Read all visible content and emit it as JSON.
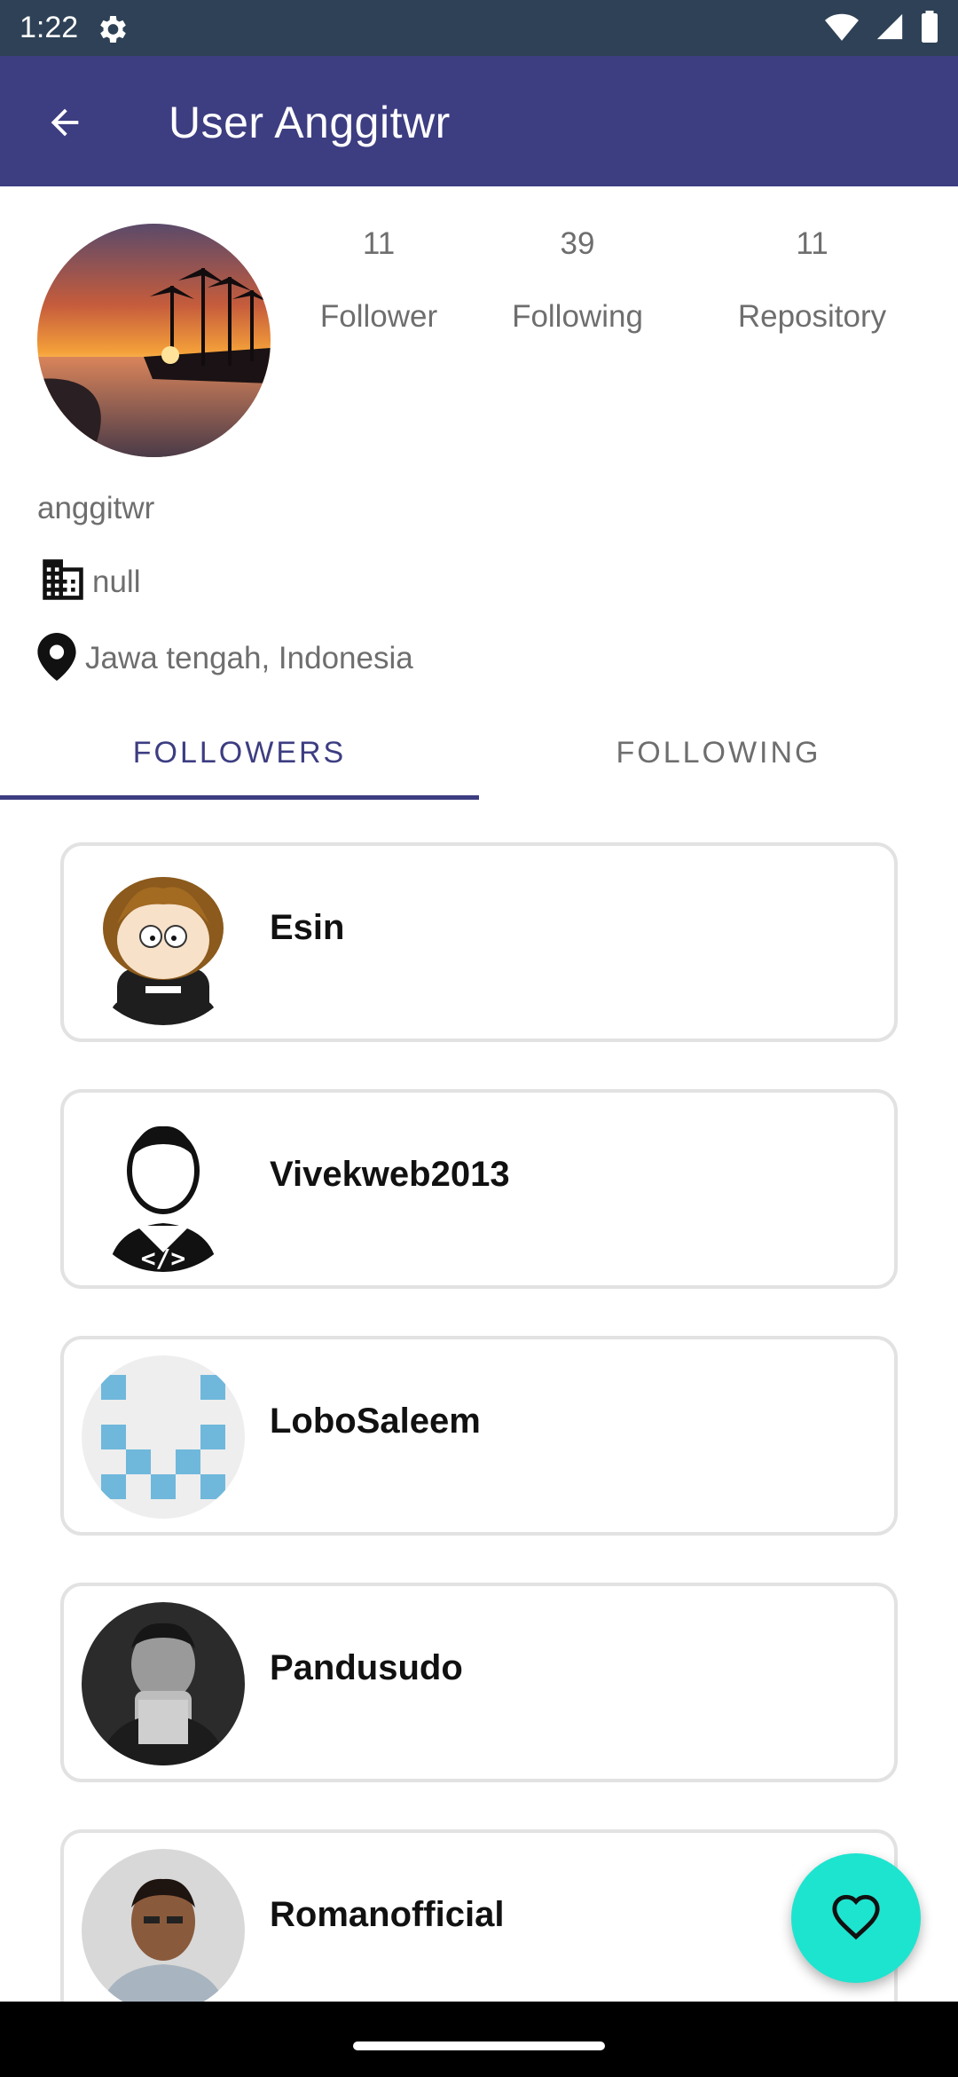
{
  "status_bar": {
    "time": "1:22"
  },
  "app_bar": {
    "title": "User Anggitwr"
  },
  "profile": {
    "stats": {
      "followers_count": "11",
      "followers_label": "Follower",
      "following_count": "39",
      "following_label": "Following",
      "repository_count": "11",
      "repository_label": "Repository"
    },
    "username": "anggitwr",
    "company": "null",
    "location": "Jawa tengah, Indonesia"
  },
  "tabs": [
    {
      "label": "FOLLOWERS",
      "selected": true
    },
    {
      "label": "FOLLOWING",
      "selected": false
    }
  ],
  "followers": [
    {
      "name": "Esin"
    },
    {
      "name": "Vivekweb2013"
    },
    {
      "name": "LoboSaleem"
    },
    {
      "name": "Pandusudo"
    },
    {
      "name": "Romanofficial"
    }
  ],
  "colors": {
    "app_bar": "#3d3d82",
    "status_bar": "#2e4156",
    "fab": "#1de4cf",
    "accent": "#3d3d82"
  }
}
